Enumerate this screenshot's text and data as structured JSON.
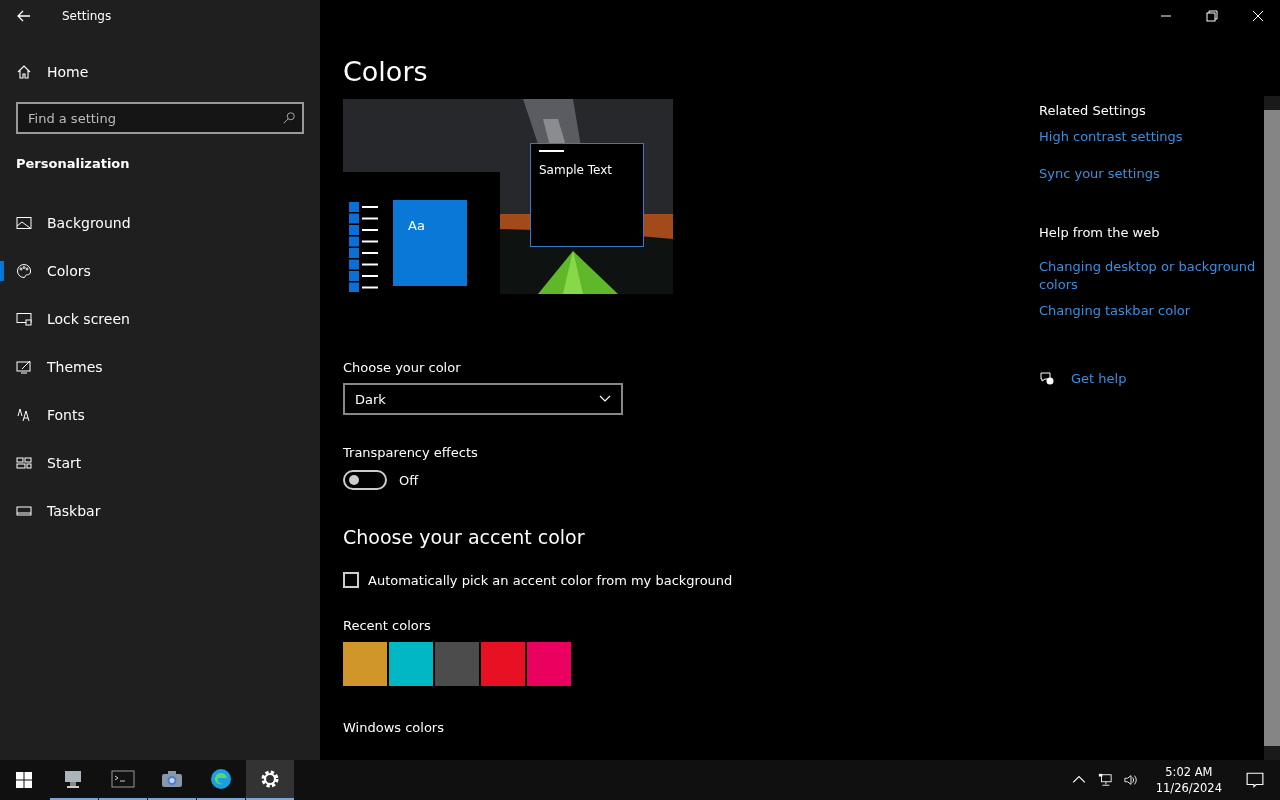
{
  "window": {
    "title": "Settings"
  },
  "sidebar": {
    "home": "Home",
    "search": {
      "placeholder": "Find a setting"
    },
    "section": "Personalization",
    "items": [
      {
        "label": "Background",
        "kind": "background",
        "selected": false
      },
      {
        "label": "Colors",
        "kind": "colors",
        "selected": true
      },
      {
        "label": "Lock screen",
        "kind": "lock",
        "selected": false
      },
      {
        "label": "Themes",
        "kind": "themes",
        "selected": false
      },
      {
        "label": "Fonts",
        "kind": "fonts",
        "selected": false
      },
      {
        "label": "Start",
        "kind": "start",
        "selected": false
      },
      {
        "label": "Taskbar",
        "kind": "taskbar",
        "selected": false
      }
    ]
  },
  "main": {
    "title": "Colors",
    "preview": {
      "tile_text": "Aa",
      "sample_text": "Sample Text"
    },
    "choose_color": {
      "label": "Choose your color",
      "value": "Dark"
    },
    "transparency": {
      "label": "Transparency effects",
      "on": false,
      "state_text": "Off"
    },
    "accent_title": "Choose your accent color",
    "auto_pick": {
      "label": "Automatically pick an accent color from my background",
      "checked": false
    },
    "recent_label": "Recent colors",
    "recent_colors": [
      {
        "color": "#d0962a"
      },
      {
        "color": "#00b7c3"
      },
      {
        "color": "#4c4c4c"
      },
      {
        "color": "#e81123"
      },
      {
        "color": "#ea005e"
      }
    ],
    "windows_colors_label": "Windows colors"
  },
  "related": {
    "title": "Related Settings",
    "links": [
      "High contrast settings",
      "Sync your settings"
    ]
  },
  "help": {
    "title": "Help from the web",
    "links": [
      "Changing desktop or background colors",
      "Changing taskbar color"
    ],
    "get_help": "Get help"
  },
  "taskbar": {
    "apps": [
      {
        "kind": "network",
        "selected": false
      },
      {
        "kind": "terminal",
        "selected": false
      },
      {
        "kind": "camera",
        "selected": false
      },
      {
        "kind": "browser",
        "selected": false
      },
      {
        "kind": "settings",
        "selected": true
      }
    ],
    "time": "5:02 AM",
    "date": "11/26/2024"
  }
}
